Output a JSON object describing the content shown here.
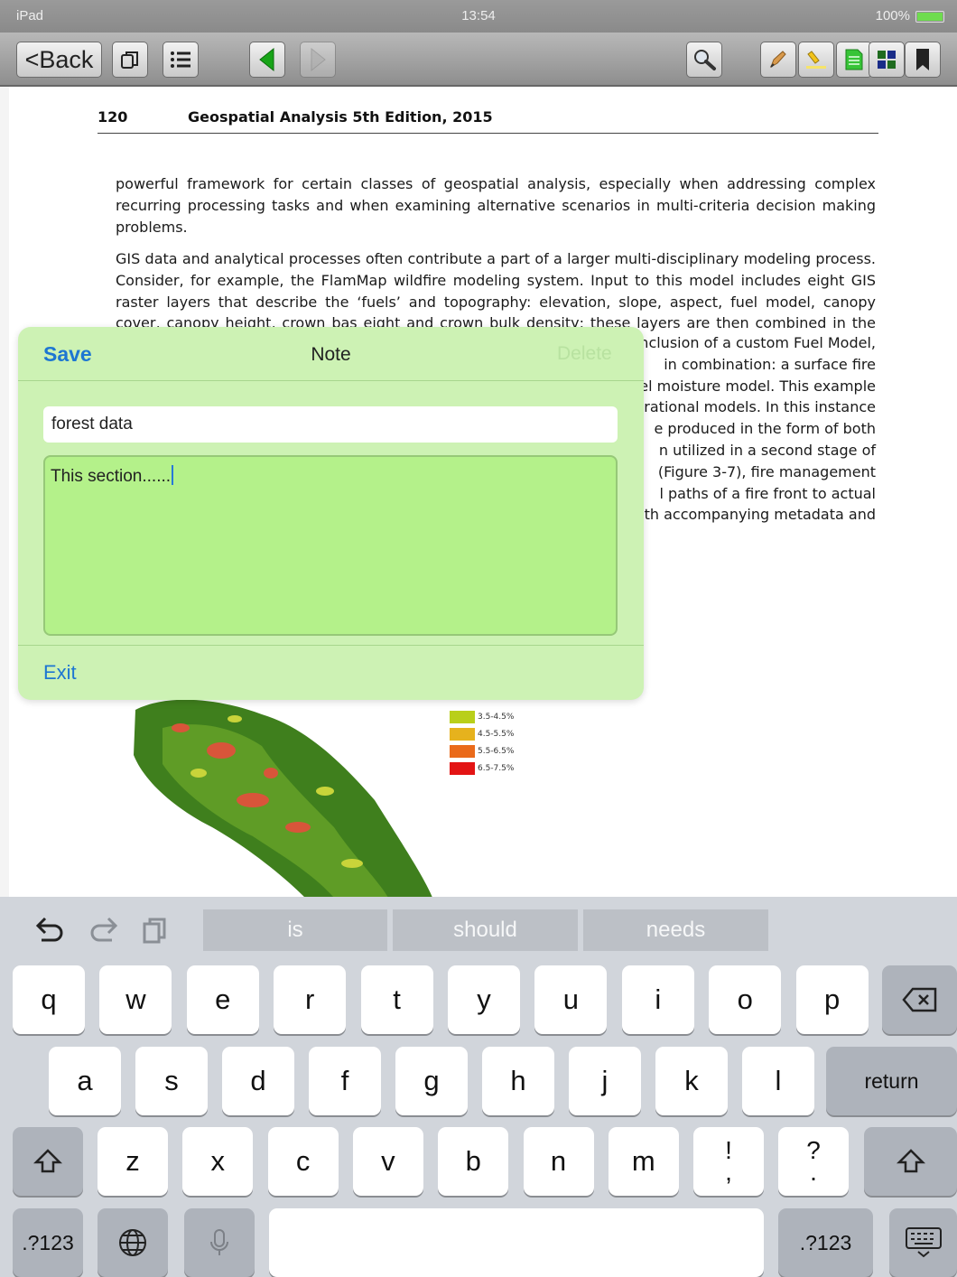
{
  "status": {
    "device": "iPad",
    "time": "13:54",
    "battery": "100%"
  },
  "toolbar": {
    "back_label": "<Back",
    "icons": [
      "copy-icon",
      "list-icon",
      "prev-page-icon",
      "next-page-icon",
      "search-icon",
      "pen-icon",
      "highlighter-icon",
      "note-icon",
      "grid-icon",
      "bookmark-icon"
    ]
  },
  "page": {
    "page_number": "120",
    "running_title": "Geospatial Analysis 5th Edition, 2015",
    "para1": "powerful framework for certain classes of geospatial analysis, especially when addressing complex recurring processing tasks and when examining alternative scenarios in multi-criteria decision making problems.",
    "para2_full": "GIS data and analytical processes often contribute a part of a larger multi-disciplinary modeling process. Consider, for example, the FlamMap wildfire modeling system. Input to this model includes eight GIS raster layers that describe the ‘fuels’ and topography: elevation, slope, aspect, fuel model, canopy cover,",
    "para2_partial": "canopy height, crown bas    eight and crown bulk density; these layers are then combined in the model",
    "para2_visible_lines": [
      "nclusion of a custom Fuel Model,",
      "in combination: a surface fire",
      "el moisture model. This example",
      "rational models. In this instance",
      "e produced in the form of both",
      "n utilized in a second stage of",
      "(Figure 3-7), fire management",
      "l paths of a fire front to actual",
      "ith accompanying metadata and"
    ],
    "legend": [
      {
        "label": "3.5-4.5%",
        "color": "#b9cf1a"
      },
      {
        "label": "4.5-5.5%",
        "color": "#e6b21d"
      },
      {
        "label": "5.5-6.5%",
        "color": "#ea6a1a"
      },
      {
        "label": "6.5-7.5%",
        "color": "#e31414"
      }
    ]
  },
  "note_dialog": {
    "save_label": "Save",
    "title": "Note",
    "delete_label": "Delete",
    "title_field_value": "forest data",
    "body_value": "This section......",
    "exit_label": "Exit"
  },
  "keyboard": {
    "suggestions": [
      "is",
      "should",
      "needs"
    ],
    "row1": [
      "q",
      "w",
      "e",
      "r",
      "t",
      "y",
      "u",
      "i",
      "o",
      "p"
    ],
    "row2": [
      "a",
      "s",
      "d",
      "f",
      "g",
      "h",
      "j",
      "k",
      "l"
    ],
    "row3": [
      "z",
      "x",
      "c",
      "v",
      "b",
      "n",
      "m"
    ],
    "return_label": "return",
    "numbers_label": ".?123",
    "punct1": "!\n,",
    "punct2": "?\n."
  },
  "colors": {
    "dialog_bg": "#cdf2b4",
    "dialog_textarea": "#b4f18a",
    "link_blue": "#1d76d2"
  }
}
